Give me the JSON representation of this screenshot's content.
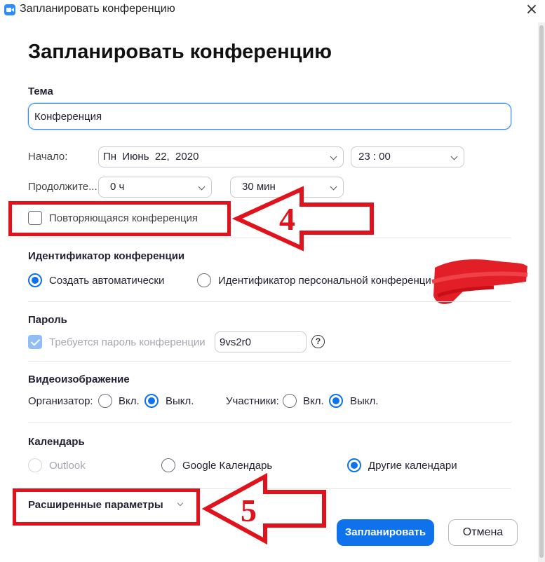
{
  "window": {
    "title": "Запланировать конференцию",
    "close_glyph": "×"
  },
  "page_title": "Запланировать конференцию",
  "topic": {
    "label": "Тема",
    "value": "Конференция"
  },
  "start": {
    "label": "Начало:",
    "date_value": "Пн  Июнь  22,  2020",
    "time_value": "23 : 00"
  },
  "duration": {
    "label": "Продолжите...",
    "hours_value": "0 ч",
    "minutes_value": "30 мин"
  },
  "recurring": {
    "label": "Повторяющаяся конференция",
    "checked": false
  },
  "meeting_id": {
    "label": "Идентификатор конференции",
    "options": [
      {
        "label": "Создать автоматически",
        "selected": true
      },
      {
        "label": "Идентификатор персональной конференци",
        "selected": false
      }
    ]
  },
  "password": {
    "label": "Пароль",
    "checkbox_label": "Требуется пароль конференции",
    "checked": true,
    "value": "9vs2r0",
    "help_glyph": "?"
  },
  "video": {
    "label": "Видеоизображение",
    "host_label": "Организатор:",
    "participants_label": "Участники:",
    "on_label": "Вкл.",
    "off_label": "Выкл.",
    "host_on": false,
    "participants_on": false
  },
  "calendar": {
    "label": "Календарь",
    "options": [
      {
        "label": "Outlook",
        "selected": false,
        "disabled": true
      },
      {
        "label": "Google Календарь",
        "selected": false,
        "disabled": false
      },
      {
        "label": "Другие календари",
        "selected": true,
        "disabled": false
      }
    ]
  },
  "advanced": {
    "label": "Расширенные параметры"
  },
  "buttons": {
    "schedule": "Запланировать",
    "cancel": "Отмена"
  },
  "annotations": {
    "arrow_4_number": "4",
    "arrow_5_number": "5",
    "color": "#e0121b"
  },
  "colors": {
    "accent": "#0E72ED",
    "focus_border": "#2D8CFF"
  }
}
